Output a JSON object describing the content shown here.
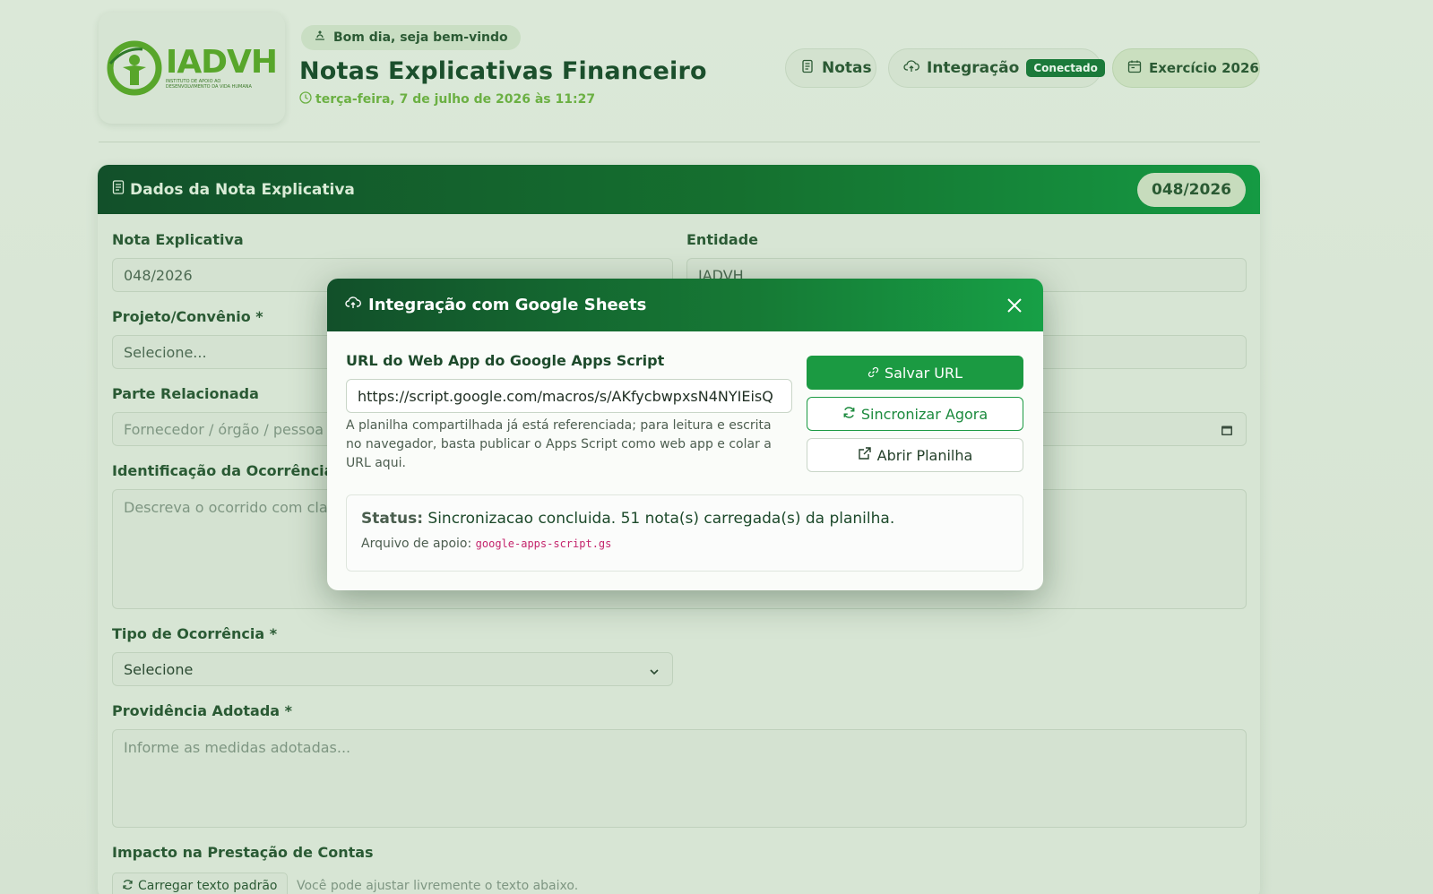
{
  "header": {
    "logo_text": "IADVH",
    "logo_subtext": "INSTITUTO DE APOIO AO DESENVOLVIMENTO DA VIDA HUMANA",
    "greeting": "Bom dia, seja bem-vindo",
    "title": "Notas Explicativas Financeiro",
    "datetime": "terça-feira, 7 de julho de 2026 às 11:27",
    "nav": {
      "notas_label": "Notas",
      "integracao_label": "Integração",
      "integracao_status": "Conectado",
      "exercicio_label": "Exercício 2026"
    }
  },
  "card": {
    "title": "Dados da Nota Explicativa",
    "number_badge": "048/2026",
    "fields": {
      "nota_label": "Nota Explicativa",
      "nota_value": "048/2026",
      "entidade_label": "Entidade",
      "entidade_value": "IADVH",
      "projeto_label": "Projeto/Convênio *",
      "projeto_value": "Selecione...",
      "parte_label": "Parte Relacionada",
      "parte_placeholder": "Fornecedor / órgão / pessoa",
      "ocorrencia_label": "Identificação da Ocorrência *",
      "ocorrencia_placeholder": "Descreva o ocorrido com cla",
      "tipo_label": "Tipo de Ocorrência *",
      "tipo_value": "Selecione",
      "providencia_label": "Providência Adotada *",
      "providencia_placeholder": "Informe as medidas adotadas...",
      "impacto_label": "Impacto na Prestação de Contas",
      "load_button": "Carregar texto padrão",
      "load_hint": "Você pode ajustar livremente o texto abaixo."
    }
  },
  "modal": {
    "title": "Integração com Google Sheets",
    "url_label": "URL do Web App do Google Apps Script",
    "url_value": "https://script.google.com/macros/s/AKfycbwpxsN4NYIEisQ",
    "help_text": "A planilha compartilhada já está referenciada; para leitura e escrita no navegador, basta publicar o Apps Script como web app e colar a URL aqui.",
    "buttons": {
      "save": "Salvar URL",
      "sync": "Sincronizar Agora",
      "open": "Abrir Planilha"
    },
    "status_label": "Status:",
    "status_text": "Sincronizacao concluida. 51 nota(s) carregada(s) da planilha.",
    "support_label": "Arquivo de apoio:",
    "support_file": "google-apps-script.gs"
  },
  "colors": {
    "brand_green": "#1b9a42",
    "dark_green": "#12502a",
    "logo_green": "#58a62b",
    "file_pink": "#c4256c"
  }
}
